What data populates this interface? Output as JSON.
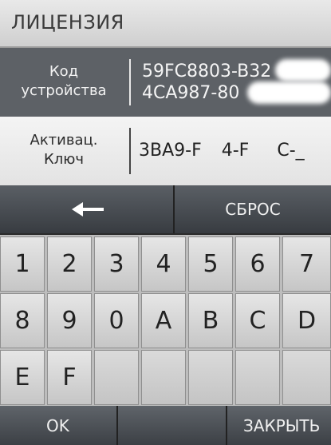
{
  "header": {
    "title": "ЛИЦЕНЗИЯ"
  },
  "device": {
    "label_line1": "Код",
    "label_line2": "устройства",
    "code_line1": "59FC8803-B32",
    "code_line2": "4CA987-80"
  },
  "activation": {
    "label_line1": "Активац.",
    "label_line2": "Ключ",
    "code_part1": "3BA9-F",
    "code_part2": "4-F",
    "code_part3": "C-_"
  },
  "controls": {
    "back_icon": "left-arrow-icon",
    "reset_label": "СБРОС"
  },
  "keypad": {
    "row1": [
      "1",
      "2",
      "3",
      "4",
      "5",
      "6",
      "7"
    ],
    "row2": [
      "8",
      "9",
      "0",
      "A",
      "B",
      "C",
      "D"
    ],
    "row3": [
      "E",
      "F",
      "",
      "",
      "",
      "",
      ""
    ]
  },
  "footer": {
    "ok_label": "OK",
    "close_label": "ЗАКРЫТЬ"
  }
}
